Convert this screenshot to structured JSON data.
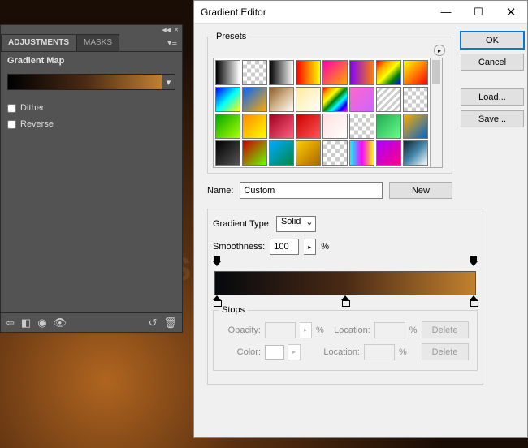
{
  "panel": {
    "tabs": {
      "adjustments": "ADJUSTMENTS",
      "masks": "MASKS"
    },
    "title": "Gradient Map",
    "dither": "Dither",
    "reverse": "Reverse"
  },
  "dialog": {
    "title": "Gradient Editor",
    "presets_legend": "Presets",
    "name_label": "Name:",
    "name_value": "Custom",
    "btn_ok": "OK",
    "btn_cancel": "Cancel",
    "btn_load": "Load...",
    "btn_save": "Save...",
    "btn_new": "New",
    "type_label": "Gradient Type:",
    "type_value": "Solid",
    "smooth_label": "Smoothness:",
    "smooth_value": "100",
    "pct": "%",
    "stops_legend": "Stops",
    "opacity_label": "Opacity:",
    "location_label": "Location:",
    "color_label": "Color:",
    "delete": "Delete"
  },
  "watermark": "WWW.PSD-DUDE.COM",
  "gradient": {
    "color_stops": [
      {
        "position": 0,
        "color": "#05080d"
      },
      {
        "position": 50,
        "color": "#4a2a15"
      },
      {
        "position": 100,
        "color": "#c2812f"
      }
    ],
    "opacity_stops": [
      {
        "position": 0,
        "opacity": 100
      },
      {
        "position": 100,
        "opacity": 100
      }
    ]
  },
  "presets": [
    "linear-gradient(to right,#000,#fff)",
    "repeating-conic-gradient(#ccc 0 25%,#fff 0 50%) 0/10px 10px",
    "linear-gradient(to right,#000,#fff)",
    "linear-gradient(to right,red,yellow)",
    "linear-gradient(135deg,#f0a,#fa0)",
    "linear-gradient(to right,#8000ff,#ff8000)",
    "linear-gradient(135deg,red,orange,yellow,green,blue)",
    "linear-gradient(135deg,#ff0,#ff8000,#f00)",
    "linear-gradient(135deg,#00f,#0ff,#ff0)",
    "linear-gradient(135deg,#06f,#fa0)",
    "linear-gradient(135deg,#8b5a2b,#d2b48c,#fff)",
    "linear-gradient(135deg,#ffeb99,#fff)",
    "linear-gradient(135deg,red,orange,yellow,green,cyan,blue,magenta)",
    "linear-gradient(135deg,#f6c,#c6f)",
    "repeating-linear-gradient(135deg,#fff 0 3px,#ccc 3px 6px)",
    "repeating-conic-gradient(#ccc 0 25%,#fff 0 50%) 0/10px 10px",
    "linear-gradient(135deg,#0a0,#af0)",
    "linear-gradient(135deg,#f80,#ff0)",
    "linear-gradient(135deg,#a00020,#ff6080)",
    "linear-gradient(135deg,#c00,#f55)",
    "linear-gradient(135deg,#ffe0e0,#fff)",
    "repeating-conic-gradient(#ccc 0 25%,#fff 0 50%) 0/10px 10px",
    "linear-gradient(135deg,#2a5,#6f8)",
    "linear-gradient(135deg,#fa0,#06c)",
    "linear-gradient(135deg,#000,#555)",
    "linear-gradient(135deg,#c00,#6f0)",
    "linear-gradient(135deg,#0af,#084)",
    "linear-gradient(135deg,#fc0,#a60)",
    "repeating-conic-gradient(#ccc 0 25%,#fff 0 50%) 0/10px 10px",
    "linear-gradient(to right,#0ff,#f0f,#ff0)",
    "linear-gradient(135deg,#a0f,#f08)",
    "linear-gradient(135deg,#123,#48a,#fff)"
  ]
}
